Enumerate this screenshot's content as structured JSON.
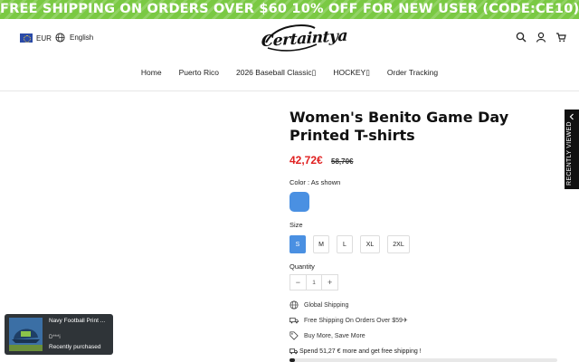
{
  "banner": {
    "text": "FREE SHIPPING ON ORDERS OVER $60  10% OFF FOR NEW USER (CODE:CE10)"
  },
  "header": {
    "currency": "EUR",
    "language": "English",
    "logo_text": "Certaintya"
  },
  "nav": {
    "items": [
      "Home",
      "Puerto Rico",
      "2026 Baseball Classic▯",
      "HOCKEY▯",
      "Order Tracking"
    ]
  },
  "product": {
    "title": "Women's Benito Game Day Printed T-shirts",
    "price": "42,72€",
    "old_price": "58,70€",
    "color_label": "Color : As shown",
    "size_label": "Size",
    "sizes": [
      "S",
      "M",
      "L",
      "XL",
      "2XL"
    ],
    "selected_size": "S",
    "quantity_label": "Quantity",
    "quantity": "1",
    "qty_minus": "−",
    "qty_plus": "+"
  },
  "features": {
    "global": "Global Shipping",
    "free": "Free Shipping On Orders Over $59✈",
    "buy_more": "Buy More, Save More"
  },
  "spend": {
    "text": "Spend 51,27 € more and get free shipping !",
    "progress": 0.02
  },
  "sidebar_tab": {
    "label": "RECENTLY VIEWED"
  },
  "popup": {
    "title": "Navy Football Print ...",
    "user": "D***i",
    "status": "Recently purchased"
  },
  "colors": {
    "accent": "#4a90e2",
    "banner": "#7ac943",
    "sale": "#e02020"
  }
}
